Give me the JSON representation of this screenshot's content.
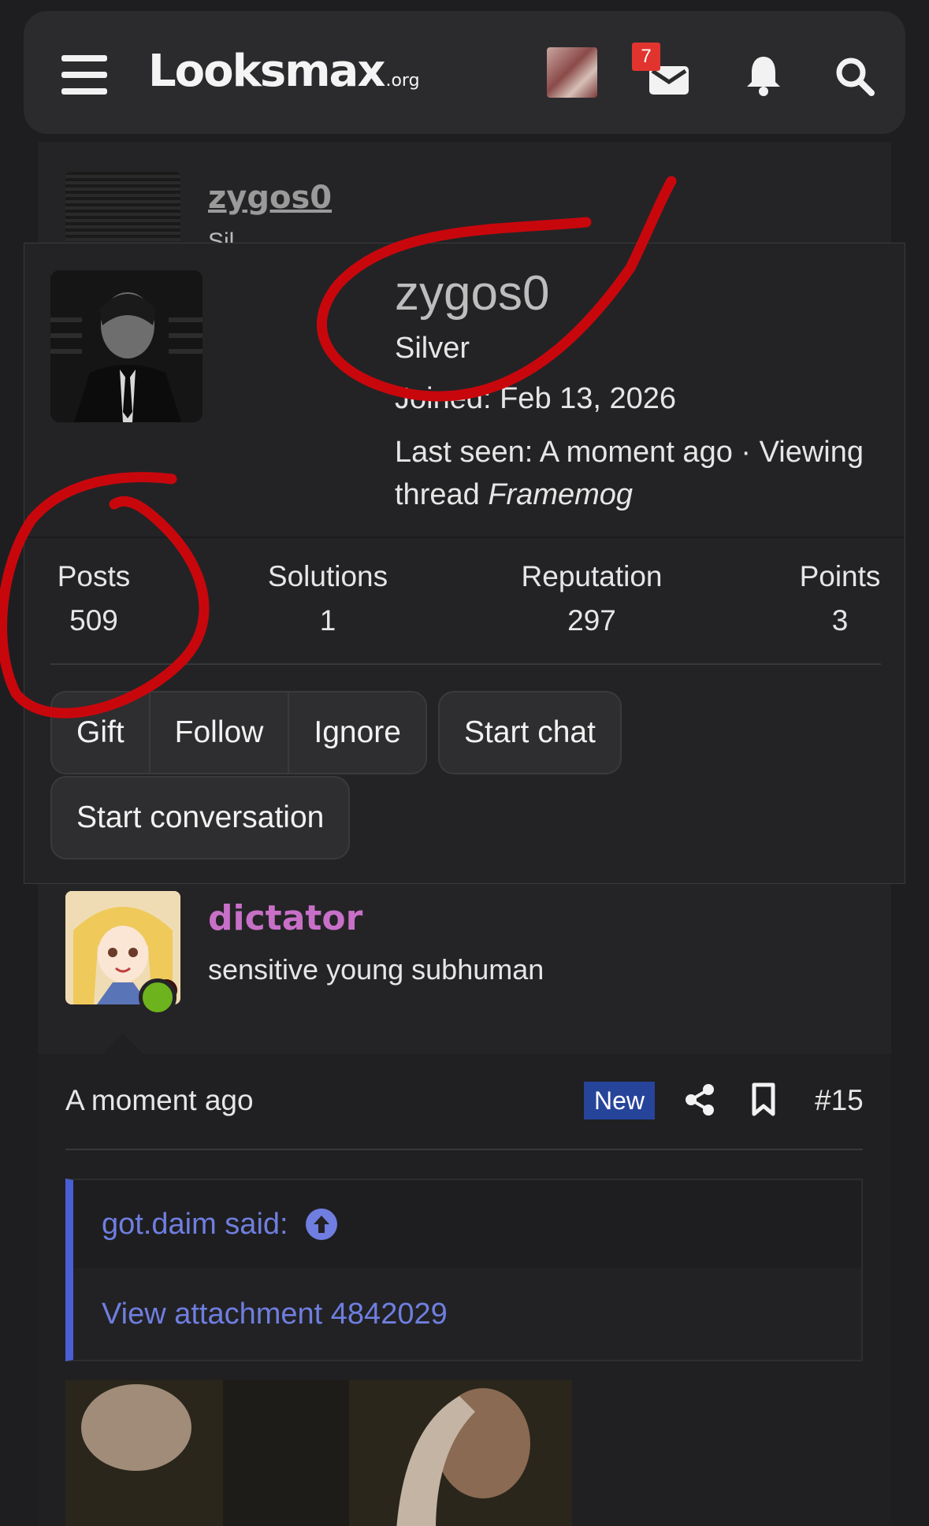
{
  "header": {
    "logo_text": "Looksmax",
    "logo_suffix": ".org",
    "notification_count": "7"
  },
  "thread_header_user": {
    "username": "zygos0",
    "title_partial": "Sil"
  },
  "profile_popup": {
    "username": "zygos0",
    "rank": "Silver",
    "joined": "Joined: Feb 13, 2026",
    "last_seen": "Last seen: A moment ago · Viewing thread",
    "last_seen_thread": "Framemog",
    "stats": [
      {
        "label": "Posts",
        "value": "509"
      },
      {
        "label": "Solutions",
        "value": "1"
      },
      {
        "label": "Reputation",
        "value": "297"
      },
      {
        "label": "Points",
        "value": "3"
      }
    ],
    "buttons": {
      "gift": "Gift",
      "follow": "Follow",
      "ignore": "Ignore",
      "start_chat": "Start chat",
      "start_conversation": "Start conversation"
    }
  },
  "post": {
    "author": "dictator",
    "author_title": "sensitive young subhuman",
    "time": "A moment ago",
    "new_badge": "New",
    "post_number": "#15",
    "quote_author": "got.daim said:",
    "quote_content": "View attachment 4842029"
  },
  "colors": {
    "background": "#1e1e20",
    "accent_link": "#6f7ee0",
    "new_badge": "#27449b",
    "notification_badge": "#e2342f",
    "online_dot": "#6db31d",
    "username_dictator": "#c870c8",
    "annotation_red": "#c8070d"
  }
}
